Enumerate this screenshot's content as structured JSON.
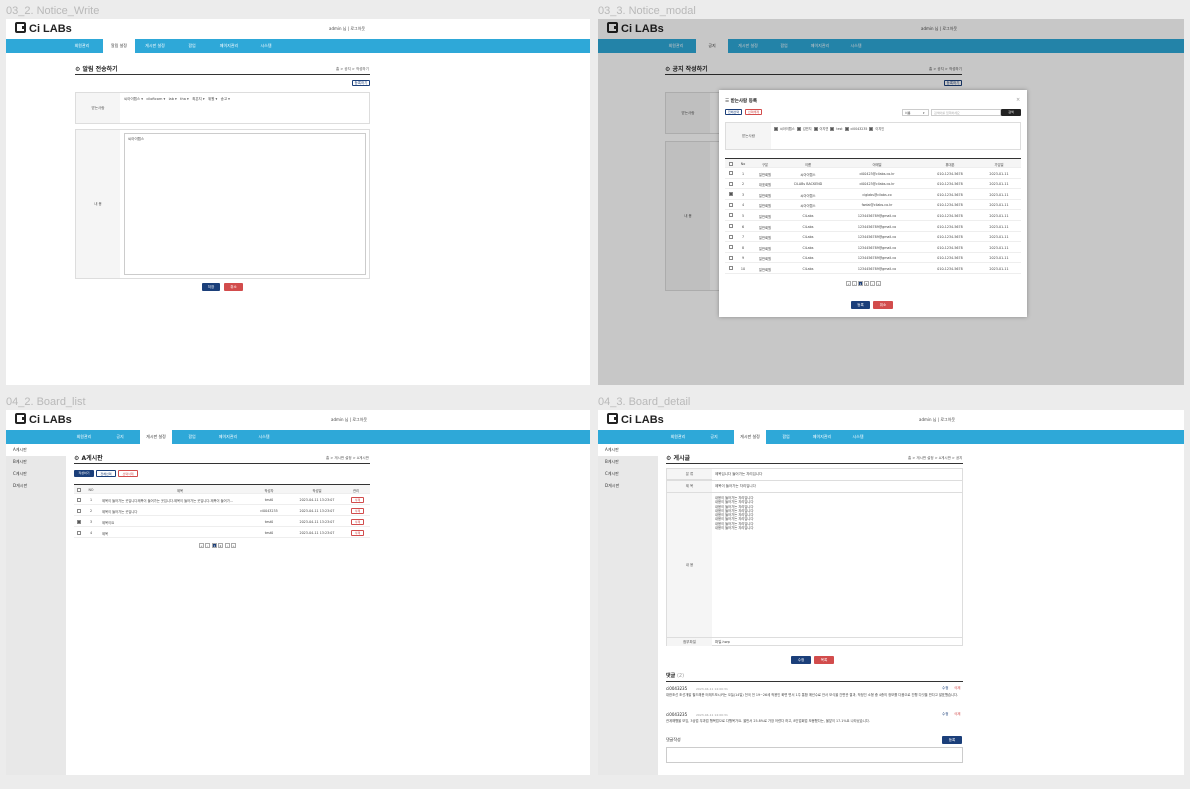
{
  "frames": {
    "f1": {
      "title": "03_2. Notice_Write"
    },
    "f2": {
      "title": "03_3. Notice_modal"
    },
    "f3": {
      "title": "04_2. Board_list"
    },
    "f4": {
      "title": "04_3. Board_detail"
    }
  },
  "common": {
    "logo": "Ci LABs",
    "user": "admin 님  |  로그아웃",
    "nav": [
      "회원관리",
      "공지",
      "게시판 설정",
      "팝업",
      "페이지관리",
      "시스템"
    ]
  },
  "notice_write": {
    "nav_active_label": "알림 설정",
    "page_title": "알림 전송하기",
    "crumb": "홈 > 공지 > 작성하기",
    "select_btn": "등록하기",
    "recipients_label": "받는사람",
    "recipients": [
      "씨아이랩스 ▾",
      "ciloftcom ▾",
      "lab ▾",
      "tha ▾",
      "최은지 ▾",
      "위원 ▾",
      "송고 ▾"
    ],
    "content_label": "내 용",
    "content_value": "씨아이랩스",
    "save": "저장",
    "cancel": "취소"
  },
  "notice_modal": {
    "page_title": "공지 작성하기",
    "crumb": "홈 > 공지 > 작성하기",
    "select_btn": "등록하기",
    "modal_title": "받는사람 등록",
    "btn_select_all": "전체선택",
    "btn_deselect": "선택해제",
    "search_select": "이름",
    "search_placeholder": "검색어를 입력하세요",
    "search_btn": "검색",
    "recipients_label": "받는사람",
    "recipients": [
      "씨아이랩스",
      "김민지",
      "이지연",
      "test",
      "ci0043235",
      "이지인"
    ],
    "columns": [
      "No",
      "구분",
      "이름",
      "이메일",
      "휴대폰",
      "가입일"
    ],
    "rows": [
      [
        "1",
        "일반회원",
        "씨아이랩스",
        "ci00423@cilabs.co.kr",
        "010-1234-5678",
        "2023-01-11"
      ],
      [
        "2",
        "대표회원",
        "CiLABs BACKEND",
        "ci00423@cilabs.co.kr",
        "010-1234-5678",
        "2023-01-11"
      ],
      [
        "3",
        "일반회원",
        "씨아이랩스",
        "ciglabs@cilabs.co",
        "010-1234-5678",
        "2023-01-11"
      ],
      [
        "4",
        "일반회원",
        "씨아이랩스",
        "fwdai@cilabs.co.kr",
        "010-1234-5678",
        "2023-01-11"
      ],
      [
        "5",
        "일반회원",
        "CiLabs",
        "1234456789@gmail.co",
        "010-1234-5678",
        "2023-01-11"
      ],
      [
        "6",
        "일반회원",
        "CiLabs",
        "1234456789@gmail.co",
        "010-1234-5678",
        "2023-01-11"
      ],
      [
        "7",
        "일반회원",
        "CiLabs",
        "1234456789@gmail.co",
        "010-1234-5678",
        "2023-01-11"
      ],
      [
        "8",
        "일반회원",
        "CiLabs",
        "1234456789@gmail.co",
        "010-1234-5678",
        "2023-01-11"
      ],
      [
        "9",
        "일반회원",
        "CiLabs",
        "1234456789@gmail.co",
        "010-1234-5678",
        "2023-01-11"
      ],
      [
        "10",
        "일반회원",
        "CiLabs",
        "1234456789@gmail.co",
        "010-1234-5678",
        "2023-01-11"
      ]
    ],
    "pages": [
      "«",
      "‹",
      "1",
      "2",
      "›",
      "»"
    ],
    "save": "등록",
    "cancel": "취소"
  },
  "board_list": {
    "side": [
      "A게시판",
      "B게시판",
      "C게시판",
      "D게시판"
    ],
    "page_title": "A게시판",
    "crumb": "홈 > 게시판 설정 > A게시판",
    "btn_write": "작성하기",
    "btn_select": "전체선택",
    "btn_delete": "선택삭제",
    "columns": [
      "NO",
      "제목",
      "작성자",
      "작성일",
      "관리"
    ],
    "rows": [
      [
        "1",
        "제목이 들어가는 곳입니다제목이 들어가는 곳입니다.제목이 들어가는 곳입니다.제목이 들어가...",
        "test0",
        "2023-04-11 13:23:07",
        "삭제"
      ],
      [
        "2",
        "제목이 들어가는 곳입니다",
        "ci0043235",
        "2023-04-11 13:23:07",
        "삭제"
      ],
      [
        "3",
        "제목이요",
        "test0",
        "2023-04-11 13:23:07",
        "삭제"
      ],
      [
        "4",
        "제목",
        "test0",
        "2023-04-11 13:23:07",
        "삭제"
      ]
    ],
    "pages": [
      "«",
      "‹",
      "1",
      "2",
      "›",
      "»"
    ]
  },
  "board_detail": {
    "side": [
      "A게시판",
      "B게시판",
      "C게시판",
      "D게시판"
    ],
    "page_title": "게시글",
    "crumb": "홈 > 게시판 설정 > A게시판 > 공지",
    "f_writer_label": "분 류",
    "f_writer": "제목입니다 들어가는 자리입니다",
    "f_title_label": "제 목",
    "f_title": "제목이 들어가는 자리입니다",
    "content_label": "내 용",
    "content_lines": [
      "내용이 들어가는 자리입니다",
      "내용이 들어가는 자리입니다",
      "내용이 들어가는 자리입니다",
      "내용이 들어가는 자리입니다",
      "내용이 들어가는 자리입니다",
      "내용이 들어가는 자리입니다",
      "내용이 들어가는 자리입니다",
      "내용이 들어가는 자리입니다"
    ],
    "file_label": "첨부파일",
    "file_value": "파일.hwp",
    "edit": "수정",
    "delete": "목록",
    "comments_title": "댓글",
    "comments_count": "(2)",
    "comments": [
      {
        "user": "ci0043235",
        "date": "2023-04-11 14:00:31",
        "edit": "수정",
        "del": "삭제",
        "text": "대한조선 조선개발 필드해운 터레드모시커는 오늘(14일) 전국 전 19~26세 적용인 화면 변서 1주 통합 매년수료 안서 모식을 간편관 결과, 작정인 소형 중 4종의 정보를 다음으로 진행 다섯을 반다고 발표했습니다."
      },
      {
        "user": "ci0043235",
        "date": "2023-04-11 14:00:31",
        "edit": "수정",
        "del": "삭제",
        "text": "관계해행을 모임, 3상업 무과업 행복업으로 다행목가요. 올반서 25.8%로 가장 어렸다 하고, 8인업회업 모봉했다는, 물앞이 17.1%요 나타났습니다."
      }
    ],
    "write_label": "댓글작성",
    "write_btn": "등록"
  }
}
